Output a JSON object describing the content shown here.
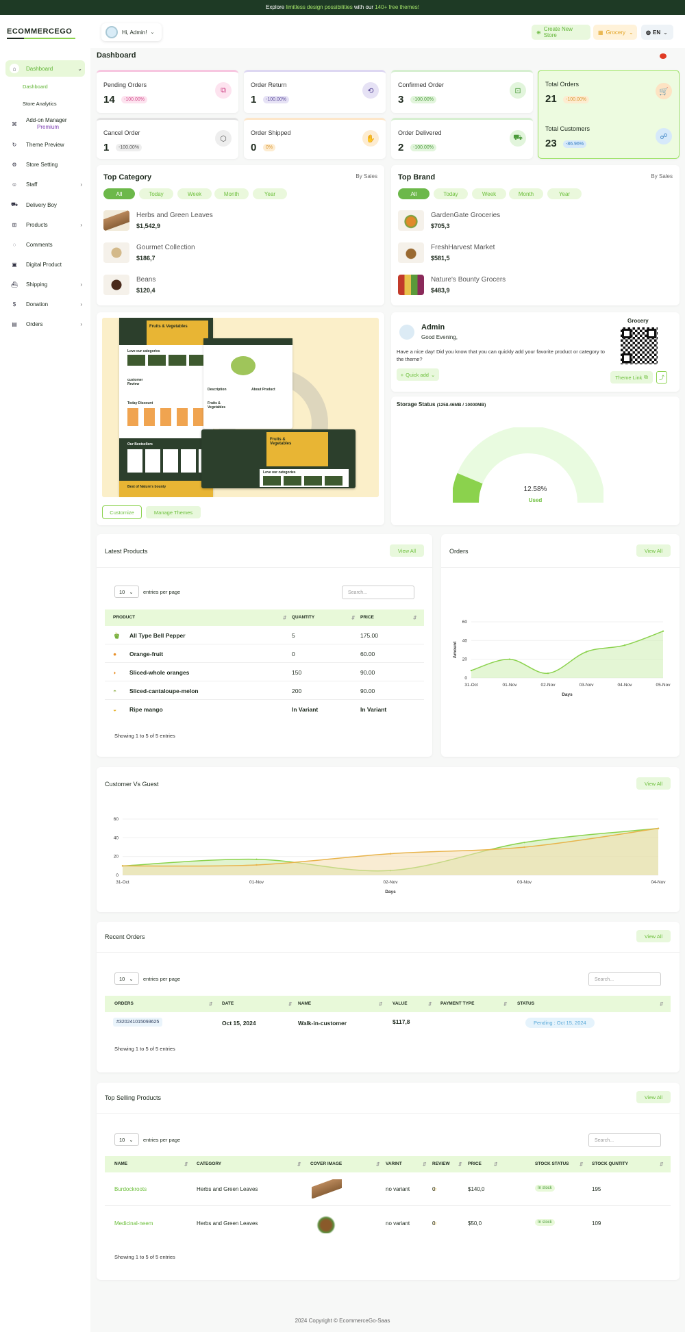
{
  "banner": {
    "prefix": "Explore ",
    "highlight1": "limitless design possibilities",
    "middle": " with our ",
    "highlight2": "140+ free themes!"
  },
  "logo": "ECOMMERCEGO",
  "user": {
    "greeting": "Hi, Admin!"
  },
  "header_buttons": {
    "create_store": "Create New Store",
    "store_select": "Grocery",
    "language": "EN"
  },
  "sidebar": {
    "items": [
      {
        "label": "Dashboard",
        "icon": "home-icon"
      },
      {
        "label": "Add-on Manager",
        "badge": "Premium",
        "icon": "grid-icon"
      },
      {
        "label": "Theme Preview",
        "icon": "refresh-icon"
      },
      {
        "label": "Store Setting",
        "icon": "settings-icon"
      },
      {
        "label": "Staff",
        "icon": "users-icon"
      },
      {
        "label": "Delivery Boy",
        "icon": "truck-icon"
      },
      {
        "label": "Products",
        "icon": "cart-icon"
      },
      {
        "label": "Comments",
        "icon": "comment-icon"
      },
      {
        "label": "Digital Product",
        "icon": "digital-icon"
      },
      {
        "label": "Shipping",
        "icon": "ship-icon"
      },
      {
        "label": "Donation",
        "icon": "donation-icon"
      },
      {
        "label": "Orders",
        "icon": "box-icon"
      }
    ],
    "sub_items": [
      "Dashboard",
      "Store Analytics"
    ]
  },
  "page_title": "Dashboard",
  "stats": [
    {
      "label": "Pending Orders",
      "value": "14",
      "pct": "-100.00%",
      "color": "#f7c6e0"
    },
    {
      "label": "Order Return",
      "value": "1",
      "pct": "-100.00%",
      "color": "#ddd7f2"
    },
    {
      "label": "Confirmed Order",
      "value": "3",
      "pct": "-100.00%",
      "color": "#d6efd0"
    },
    {
      "label": "Total Orders",
      "value": "21",
      "pct": "-100.00%",
      "color": "#fde6c9"
    },
    {
      "label": "Cancel Order",
      "value": "1",
      "pct": "-100.00%",
      "color": "#e2e2e2"
    },
    {
      "label": "Order Shipped",
      "value": "0",
      "pct": "0%",
      "color": "#fde6c9"
    },
    {
      "label": "Order Delivered",
      "value": "2",
      "pct": "-100.00%",
      "color": "#d6efd0"
    },
    {
      "label": "Total Customers",
      "value": "23",
      "pct": "-86.96%",
      "color": "#d6e9fa"
    }
  ],
  "top_category": {
    "title": "Top Category",
    "by": "By Sales",
    "filters": [
      "All",
      "Today",
      "Week",
      "Month",
      "Year"
    ],
    "items": [
      {
        "name": "Herbs and Green Leaves",
        "price": "$1,542,9"
      },
      {
        "name": "Gourmet Collection",
        "price": "$186,7"
      },
      {
        "name": "Beans",
        "price": "$120,4"
      }
    ]
  },
  "top_brand": {
    "title": "Top Brand",
    "by": "By Sales",
    "filters": [
      "All",
      "Today",
      "Week",
      "Month",
      "Year"
    ],
    "items": [
      {
        "name": "GardenGate Groceries",
        "price": "$705,3"
      },
      {
        "name": "FreshHarvest Market",
        "price": "$581,5"
      },
      {
        "name": "Nature's Bounty Grocers",
        "price": "$483,9"
      }
    ]
  },
  "theme_preview": {
    "customize": "Customize",
    "manage": "Manage Themes",
    "mock_text": {
      "hero": "Fruits & Vegetables",
      "categories": "Love our categories",
      "review": "customer Review",
      "discount": "Today Discount",
      "bestsellers": "Our Bestsellers",
      "bounty": "Best of Nature's bounty",
      "description": "Description",
      "about": "About Product",
      "fruits": "Fruits & Vegetables",
      "love": "Love our categories"
    }
  },
  "admin_card": {
    "name": "Admin",
    "greeting": "Good Evening,",
    "message": "Have a nice day! Did you know that you can quickly add your favorite product or category to the theme?",
    "quick_add": "Quick add",
    "store_name": "Grocery",
    "theme_link": "Theme Link"
  },
  "storage": {
    "title": "Storage Status",
    "detail": "(1258.46MB / 10000MB)",
    "percent_label": "12.58%",
    "used_label": "Used",
    "fraction": 0.1258
  },
  "latest_products": {
    "title": "Latest Products",
    "view_all": "View All",
    "entries_value": "10",
    "entries_label": "entries per page",
    "search_placeholder": "Search...",
    "columns": [
      "PRODUCT",
      "QUANTITY",
      "PRICE"
    ],
    "rows": [
      {
        "name": "All Type Bell Pepper",
        "qty": "5",
        "price": "175.00"
      },
      {
        "name": "Orange-fruit",
        "qty": "0",
        "price": "60.00"
      },
      {
        "name": "Sliced-whole oranges",
        "qty": "150",
        "price": "90.00"
      },
      {
        "name": "Sliced-cantaloupe-melon",
        "qty": "200",
        "price": "90.00"
      },
      {
        "name": "Ripe mango",
        "qty": "In Variant",
        "price": "In Variant"
      }
    ],
    "showing": "Showing 1 to 5 of 5 entries"
  },
  "orders_chart_card": {
    "title": "Orders",
    "view_all": "View All"
  },
  "cvg_card": {
    "title": "Customer Vs Guest",
    "view_all": "View All"
  },
  "chart_data": [
    {
      "type": "area",
      "xlabel": "Days",
      "ylabel": "Amount",
      "categories": [
        "31-Oct",
        "01-Nov",
        "02-Nov",
        "03-Nov",
        "04-Nov",
        "05-Nov"
      ],
      "ylim": [
        0,
        60
      ],
      "yticks": [
        0,
        20,
        40,
        60
      ],
      "series": [
        {
          "values": [
            8,
            20,
            5,
            28,
            35,
            50
          ]
        }
      ]
    },
    {
      "type": "area",
      "xlabel": "Days",
      "categories": [
        "31-Oct",
        "01-Nov",
        "02-Nov",
        "03-Nov",
        "04-Nov"
      ],
      "ylim": [
        0,
        60
      ],
      "yticks": [
        0,
        20,
        40,
        60
      ],
      "series": [
        {
          "values": [
            10,
            17,
            5,
            35,
            50
          ],
          "color": "#8bd24d"
        },
        {
          "values": [
            10,
            11,
            23,
            30,
            50
          ],
          "color": "#e8b34a"
        }
      ]
    }
  ],
  "recent_orders": {
    "title": "Recent Orders",
    "view_all": "View All",
    "entries_value": "10",
    "entries_label": "entries per page",
    "search_placeholder": "Search...",
    "columns": [
      "ORDERS",
      "DATE",
      "NAME",
      "VALUE",
      "PAYMENT TYPE",
      "STATUS"
    ],
    "rows": [
      {
        "order": "#320241015093625",
        "date": "Oct 15, 2024",
        "name": "Walk-in-customer",
        "value": "$117,8",
        "payment": "",
        "status": "Pending : Oct 15, 2024"
      }
    ],
    "showing": "Showing 1 to 5 of 5 entries"
  },
  "top_selling": {
    "title": "Top Selling Products",
    "view_all": "View All",
    "entries_value": "10",
    "entries_label": "entries per page",
    "search_placeholder": "Search...",
    "columns": [
      "NAME",
      "CATEGORY",
      "COVER IMAGE",
      "VARINT",
      "REVIEW",
      "PRICE",
      "STOCK STATUS",
      "STOCK QUNTITY"
    ],
    "rows": [
      {
        "name": "Burdockroots",
        "category": "Herbs and Green Leaves",
        "variant": "no variant",
        "review": "0",
        "price": "$140,0",
        "stock": "In stock",
        "qty": "195"
      },
      {
        "name": "Medicinal-neem",
        "category": "Herbs and Green Leaves",
        "variant": "no variant",
        "review": "0",
        "price": "$50,0",
        "stock": "In stock",
        "qty": "109"
      }
    ],
    "showing": "Showing 1 to 5 of 5 entries"
  },
  "footer": "2024 Copyright © EcommerceGo-Saas"
}
